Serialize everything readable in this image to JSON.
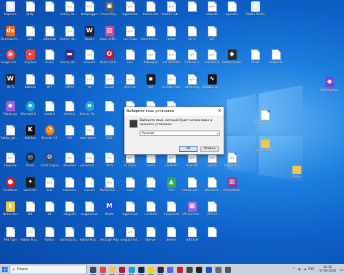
{
  "desktop": {
    "icons": [
      {
        "label": "Корзина",
        "type": "app",
        "color": "#dfe7ef",
        "glyph": "🗑"
      },
      {
        "label": "yt-dlp",
        "type": "doc"
      },
      {
        "label": "",
        "type": "doc"
      },
      {
        "label": "Granny Hammer",
        "type": "doc",
        "code": true
      },
      {
        "label": "beatplugger",
        "type": "doc",
        "code": true
      },
      {
        "label": "Crosue Playgroun",
        "type": "app",
        "color": "#5b5b5b",
        "glyph": "▣"
      },
      {
        "label": "registration",
        "type": "doc",
        "code": true
      },
      {
        "label": "Docker tool",
        "type": "doc"
      },
      {
        "label": "team16 roblocksstes",
        "type": "doc",
        "code": true
      },
      {
        "label": "",
        "type": "doc"
      },
      {
        "label": "www.ufa",
        "type": "doc",
        "code": true
      },
      {
        "label": "wyukallo",
        "type": "doc"
      },
      {
        "label": "Roblox Studio",
        "type": "app",
        "color": "#e4e9f2",
        "glyph": "◆"
      },
      {
        "label": "Download Studio",
        "type": "app",
        "color": "#ee6a1f",
        "glyph": "ds"
      },
      {
        "label": "ad1",
        "type": "doc"
      },
      {
        "label": "dd/seeds",
        "type": "doc"
      },
      {
        "label": "Granny Hammer",
        "type": "doc",
        "code": true
      },
      {
        "label": "Diplom",
        "type": "app",
        "color": "#202020",
        "glyph": "W"
      },
      {
        "label": "kuser anTel2023",
        "type": "app",
        "color": "#d44b8c",
        "glyph": "▤"
      },
      {
        "label": "sxv-Clrwa",
        "type": "doc",
        "code": true
      },
      {
        "label": "team-fe5 coolcocgi",
        "type": "doc"
      },
      {
        "label": "Iwinter",
        "type": "doc"
      },
      {
        "label": "wz-ro",
        "type": "doc"
      },
      {
        "label": "ez7",
        "type": "doc"
      },
      {
        "label": "Google Chrome",
        "type": "app",
        "color": "#e8453c",
        "glyph": "◉",
        "round": true
      },
      {
        "label": "AnyDesk",
        "type": "app",
        "color": "#ef443b",
        "glyph": "▸"
      },
      {
        "label": "eSSES",
        "type": "doc"
      },
      {
        "label": "Granny Hammer",
        "type": "app",
        "color": "#3d2a88",
        "glyph": "▬"
      },
      {
        "label": "lernpcas",
        "type": "doc",
        "code": true
      },
      {
        "label": "Opera GX Browser",
        "type": "app",
        "color": "#b8173f",
        "glyph": "O",
        "round": true
      },
      {
        "label": "rom",
        "type": "doc"
      },
      {
        "label": "Robloxgen",
        "type": "doc",
        "code": true
      },
      {
        "label": "wst7R0BLOX",
        "type": "doc",
        "code": true
      },
      {
        "label": "ProtocolFix",
        "type": "doc",
        "code": true
      },
      {
        "label": "redoDASIT",
        "type": "doc",
        "code": true
      },
      {
        "label": "Roblox Studio",
        "type": "app",
        "color": "#2b2b2b",
        "glyph": "◆"
      },
      {
        "label": "nt.dat",
        "type": "doc"
      },
      {
        "label": "redoparat",
        "type": "doc"
      },
      {
        "label": "Wi-Fi",
        "type": "app",
        "color": "#202020",
        "glyph": "W"
      },
      {
        "label": "Шаблон",
        "type": "doc"
      },
      {
        "label": "dt-7",
        "type": "doc"
      },
      {
        "label": "ioSPh0",
        "type": "doc"
      },
      {
        "label": "xtf",
        "type": "doc",
        "code": true
      },
      {
        "label": "GLuxer",
        "type": "doc",
        "code": true
      },
      {
        "label": "KAA.Sox",
        "type": "doc",
        "code": true
      },
      {
        "label": "Kol",
        "type": "app",
        "color": "#1a1a1a",
        "glyph": "▪"
      },
      {
        "label": "Complex Plan",
        "type": "doc",
        "code": true
      },
      {
        "label": "xdmb.mng",
        "type": "doc",
        "code": true
      },
      {
        "label": "AXONEL eacdxm",
        "type": "app",
        "color": "#141414",
        "glyph": "∿"
      },
      {
        "label": "Roblox.gp",
        "type": "app",
        "color": "#9a5ce0",
        "glyph": "◆"
      },
      {
        "label": "Microsoft Edge",
        "type": "app",
        "color": "#1fa0d8",
        "glyph": "e",
        "round": true
      },
      {
        "label": "noxdovl",
        "type": "doc"
      },
      {
        "label": "dematry",
        "type": "doc"
      },
      {
        "label": "Granny Hammer",
        "type": "app",
        "color": "#1fa0d8",
        "glyph": "e",
        "round": true
      },
      {
        "label": "",
        "type": "doc"
      },
      {
        "label": "",
        "type": "doc"
      },
      {
        "label": "Roblox_lmtoll",
        "type": "doc"
      },
      {
        "label": "",
        "type": "doc"
      },
      {
        "label": "Roblox_glob ntc",
        "type": "doc"
      },
      {
        "label": "NoKilton",
        "type": "app",
        "color": "#111111",
        "glyph": "K"
      },
      {
        "label": "Blender 3.5",
        "type": "app",
        "color": "#ef7b12",
        "glyph": "◔",
        "round": true
      },
      {
        "label": "A00",
        "type": "doc"
      },
      {
        "label": "team adhm mmdstan",
        "type": "doc",
        "code": true
      },
      {
        "label": "DGG",
        "type": "doc"
      },
      {
        "label": "",
        "type": "doc"
      },
      {
        "label": "Гималаи",
        "type": "doc",
        "code": true
      },
      {
        "label": "Steam",
        "type": "app",
        "color": "#1b2838",
        "glyph": "◎",
        "round": true
      },
      {
        "label": "Cheat Engine",
        "type": "app",
        "color": "#2b4e84",
        "glyph": "⚙"
      },
      {
        "label": "ditesxbox",
        "type": "doc",
        "code": true
      },
      {
        "label": "anniversar ntc-dbn",
        "type": "doc",
        "code": true
      },
      {
        "label": "DOD",
        "type": "doc",
        "code": true
      },
      {
        "label": "xC77Gbc",
        "type": "doc",
        "code": true
      },
      {
        "label": "lev.ml",
        "type": "app",
        "color": "#e9eef5",
        "glyph": "▫"
      },
      {
        "label": "dasDFhd",
        "type": "doc",
        "code": true
      },
      {
        "label": "dosk-dbl",
        "type": "doc",
        "code": true
      },
      {
        "label": "kwstfo",
        "type": "doc",
        "code": true
      },
      {
        "label": "Robloxdem",
        "type": "doc",
        "code": true
      },
      {
        "label": "SandBaxer",
        "type": "app",
        "color": "#d62020",
        "glyph": "●",
        "round": true
      },
      {
        "label": "Voxel-dev",
        "type": "app",
        "color": "#1d1d1d",
        "glyph": "✦"
      },
      {
        "label": "ditel",
        "type": "doc",
        "code": true
      },
      {
        "label": "zo6Gooss",
        "type": "doc"
      },
      {
        "label": "ecpenro",
        "type": "doc"
      },
      {
        "label": "INVIA(IUGE- esr7gh",
        "type": "doc",
        "code": true
      },
      {
        "label": "xcwa",
        "type": "doc"
      },
      {
        "label": "rom",
        "type": "doc"
      },
      {
        "label": "lfhd",
        "type": "app",
        "color": "#34a853",
        "glyph": "▲"
      },
      {
        "label": "Новый документ",
        "type": "doc"
      },
      {
        "label": "Worldslinc",
        "type": "doc"
      },
      {
        "label": "rVnRoxNuwe",
        "type": "app",
        "color": "#8b3a9c",
        "glyph": "▥"
      },
      {
        "label": "Better-Ahu",
        "type": "app",
        "color": "#f3c649",
        "glyph": "▮"
      },
      {
        "label": "WR",
        "type": "doc"
      },
      {
        "label": "x4",
        "type": "doc"
      },
      {
        "label": "adoge00",
        "type": "doc"
      },
      {
        "label": "sregshinkvik",
        "type": "doc"
      },
      {
        "label": "MVetz",
        "type": "app",
        "color": "#1a4fd8",
        "glyph": "M"
      },
      {
        "label": "regshinkvik",
        "type": "doc"
      },
      {
        "label": "ventitakl",
        "type": "doc"
      },
      {
        "label": "ShowSmall",
        "type": "doc"
      },
      {
        "label": "VPSbox tactles",
        "type": "app",
        "color": "#a063e0",
        "glyph": "▦"
      },
      {
        "label": "222222",
        "type": "doc"
      },
      {
        "label": "Red Tiger",
        "type": "doc"
      },
      {
        "label": "Roblox Players",
        "type": "doc",
        "code": true
      },
      {
        "label": "Roblox",
        "type": "doc"
      },
      {
        "label": "jamie bad bear",
        "type": "doc"
      },
      {
        "label": "Roblox Players",
        "type": "doc"
      },
      {
        "label": "Verizuge Pulp",
        "type": "doc"
      },
      {
        "label": "sceptatmed Mac-0001",
        "type": "doc",
        "code": true
      },
      {
        "label": "hbb-vm",
        "type": "doc"
      },
      {
        "label": "aewdm",
        "type": "doc"
      },
      {
        "label": "wIF2SCH",
        "type": "doc"
      },
      {
        "label": "",
        "type": "doc"
      },
      {
        "label": "OnlineDelete",
        "type": "doc"
      }
    ],
    "right_icons": [
      {
        "label": "Roblox player",
        "type": "app",
        "color": "#7b42d6",
        "glyph": "◆"
      },
      {
        "label": "Roblox_setup_1_Wireframe",
        "type": "doc"
      },
      {
        "label": "Roblox-studio",
        "type": "folder"
      },
      {
        "label": "Roblox",
        "type": "folder"
      }
    ]
  },
  "dialog": {
    "title": "Выберите язык установки",
    "close_glyph": "✕",
    "message": "Выберите язык, который будет использован в процессе установки:",
    "language_value": "Русский",
    "dropdown_arrow": "▾",
    "ok_label": "OK",
    "cancel_label": "Отмена"
  },
  "taskbar": {
    "search_placeholder": "Поиск",
    "search_icon": "⌕",
    "apps": [
      {
        "name": "task-view",
        "color": "#3c4a5a"
      },
      {
        "name": "chrome",
        "color": "#e8453c"
      },
      {
        "name": "file-explorer",
        "color": "#f3c649"
      },
      {
        "name": "opera-gx",
        "color": "#b8173f"
      },
      {
        "name": "edge",
        "color": "#1fa0d8"
      },
      {
        "name": "steam",
        "color": "#1b2838"
      },
      {
        "name": "yandex",
        "color": "#ffcc00"
      },
      {
        "name": "roblox",
        "color": "#2b2b2b"
      },
      {
        "name": "discord",
        "color": "#5865f2"
      },
      {
        "name": "app-red",
        "color": "#d62020"
      },
      {
        "name": "app-dark",
        "color": "#444444"
      },
      {
        "name": "app-roblox-studio",
        "color": "#222222"
      },
      {
        "name": "app-blue",
        "color": "#1a4fd8"
      },
      {
        "name": "app-gray",
        "color": "#6a6a6a"
      },
      {
        "name": "app-setup",
        "color": "#555555"
      }
    ],
    "tray": {
      "language": "РУС",
      "time": "16:30",
      "date": "17.09.2024"
    }
  }
}
